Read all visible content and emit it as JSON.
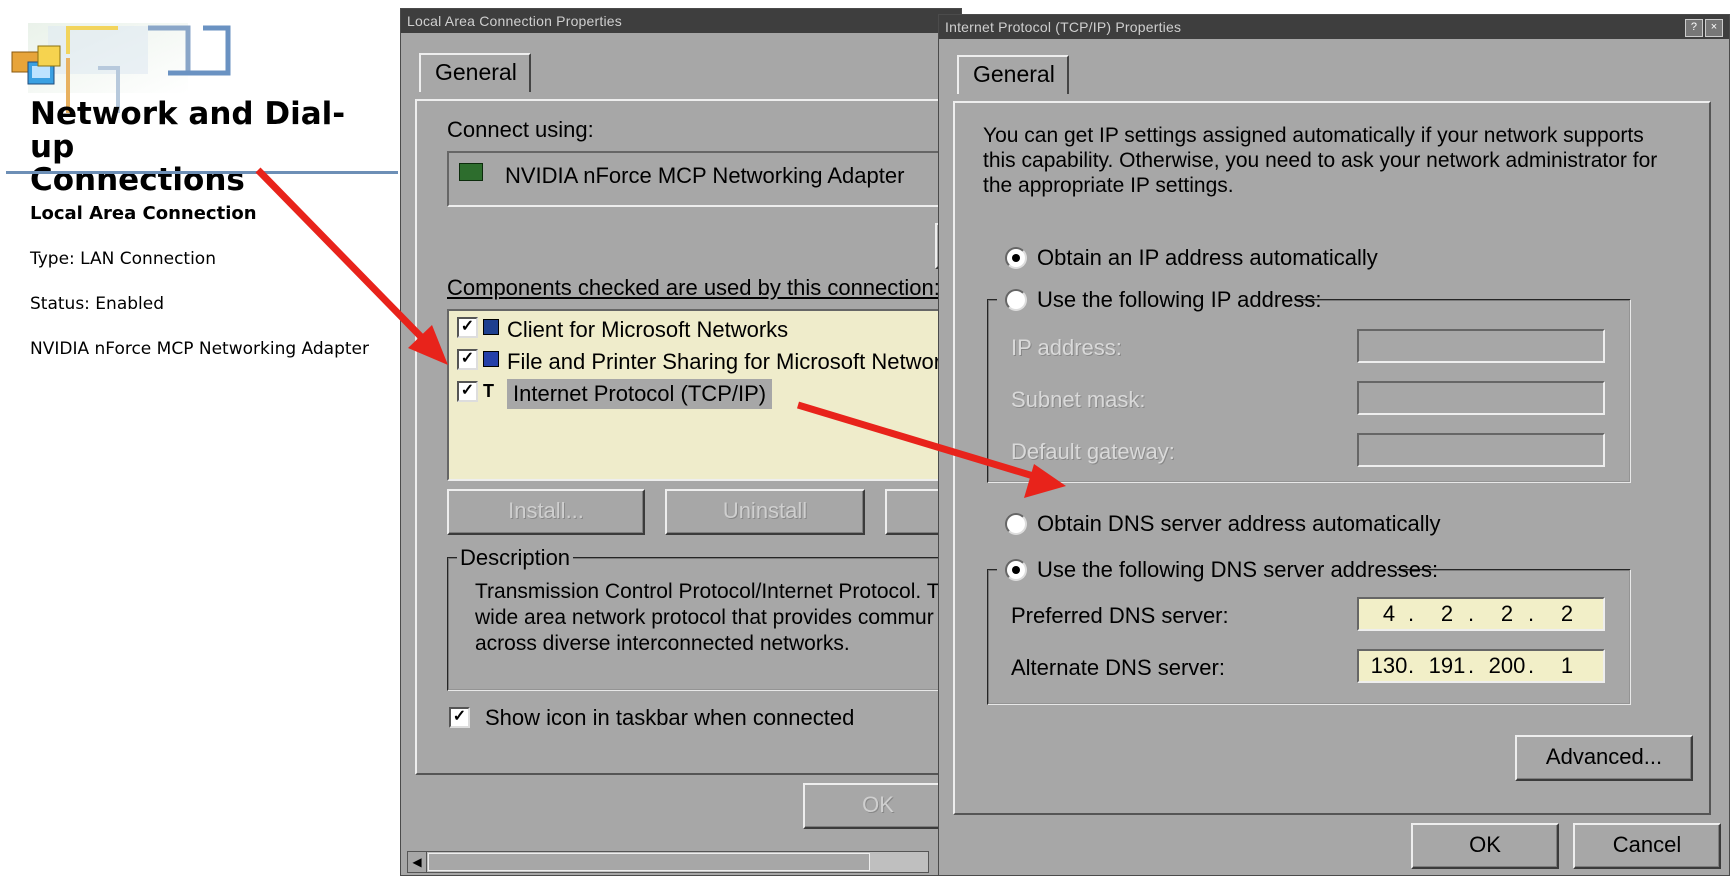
{
  "left_panel": {
    "title_line1": "Network and Dial-up",
    "title_line2": "Connections",
    "connection_name": "Local Area Connection",
    "type": "Type: LAN Connection",
    "status": "Status: Enabled",
    "adapter": "NVIDIA nForce MCP Networking Adapter"
  },
  "lan_dialog": {
    "title": "Local Area Connection Properties",
    "tab": "General",
    "connect_using_label": "Connect using:",
    "adapter_name": "NVIDIA nForce MCP Networking Adapter",
    "components_label": "Components checked are used by this connection:",
    "components": [
      {
        "label": "Client for Microsoft Networks",
        "checked": true
      },
      {
        "label": "File and Printer Sharing for Microsoft Network",
        "checked": true
      },
      {
        "label": "Internet Protocol (TCP/IP)",
        "checked": true,
        "selected": true
      }
    ],
    "install_button": "Install...",
    "uninstall_button": "Uninstall",
    "description_legend": "Description",
    "description_lines": [
      "Transmission Control Protocol/Internet Protocol. T",
      "wide area network protocol that provides commur",
      "across diverse interconnected networks."
    ],
    "show_icon_label": "Show icon in taskbar when connected",
    "show_icon_checked": true,
    "ok_button": "OK"
  },
  "tcpip_dialog": {
    "title": "Internet Protocol (TCP/IP) Properties",
    "tab": "General",
    "intro_lines": [
      "You can get IP settings assigned automatically if your network supports",
      "this capability. Otherwise, you need to ask your network administrator for",
      "the appropriate IP settings."
    ],
    "obtain_ip_auto": "Obtain an IP address automatically",
    "use_following_ip": "Use the following IP address:",
    "ip_address_label": "IP address:",
    "subnet_mask_label": "Subnet mask:",
    "default_gateway_label": "Default gateway:",
    "obtain_dns_auto": "Obtain DNS server address automatically",
    "use_following_dns": "Use the following DNS server addresses:",
    "preferred_dns_label": "Preferred DNS server:",
    "preferred_dns": [
      "4",
      "2",
      "2",
      "2"
    ],
    "alternate_dns_label": "Alternate DNS server:",
    "alternate_dns": [
      "130",
      "191",
      "200",
      "1"
    ],
    "advanced_button": "Advanced...",
    "ok_button": "OK",
    "cancel_button": "Cancel",
    "ip_mode": "automatic",
    "dns_mode": "manual"
  },
  "colors": {
    "dialog_bg": "#a7a7a7",
    "list_bg": "#efeccb",
    "arrow": "#e8231b",
    "rule": "#6d8fb6"
  }
}
